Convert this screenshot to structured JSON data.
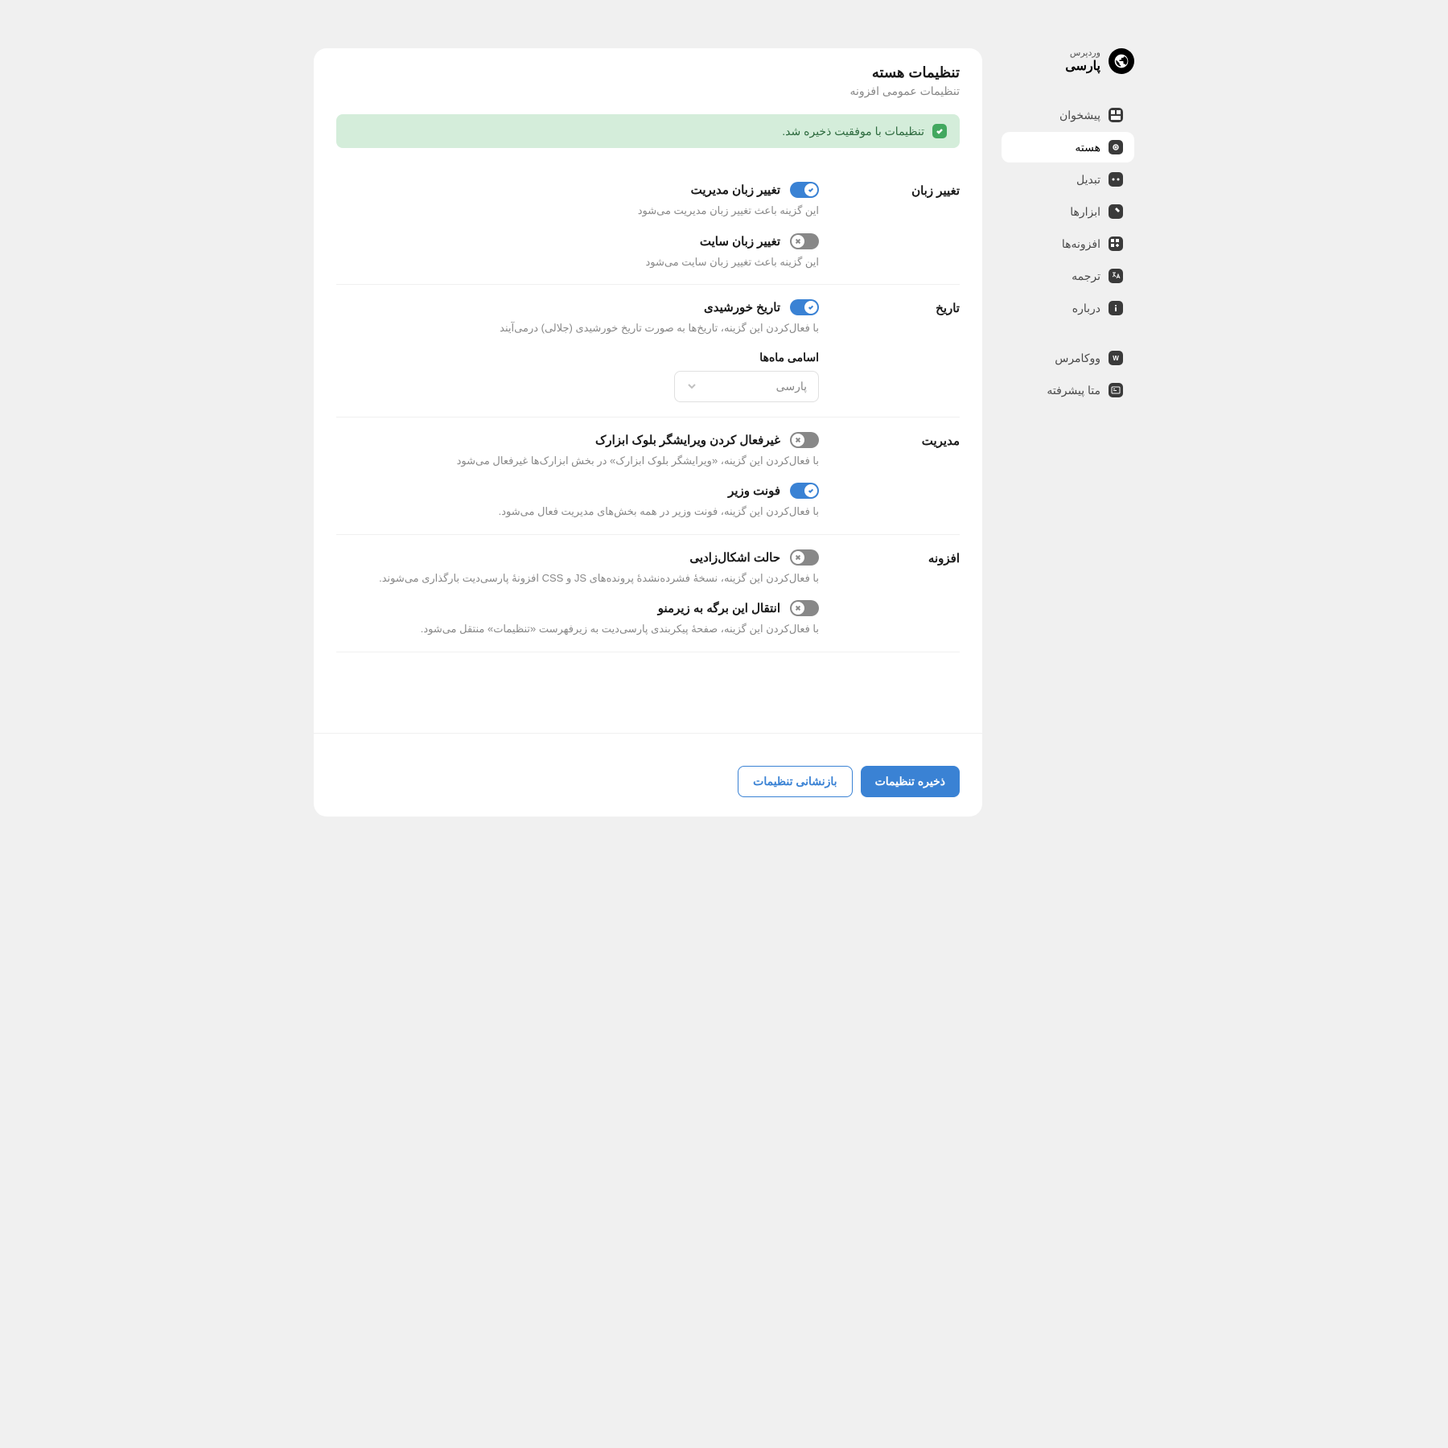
{
  "logo": {
    "sub": "وردپرس",
    "main": "پارسی"
  },
  "nav": {
    "primary": [
      {
        "label": "پیشخوان",
        "icon": "dashboard"
      },
      {
        "label": "هسته",
        "icon": "core",
        "active": true
      },
      {
        "label": "تبدیل",
        "icon": "convert"
      },
      {
        "label": "ابزارها",
        "icon": "tools"
      },
      {
        "label": "افزونه‌ها",
        "icon": "plugins"
      },
      {
        "label": "ترجمه",
        "icon": "translate"
      },
      {
        "label": "درباره",
        "icon": "info"
      }
    ],
    "secondary": [
      {
        "label": "ووکامرس",
        "icon": "woocommerce"
      },
      {
        "label": "متا پیشرفته",
        "icon": "acf"
      }
    ]
  },
  "header": {
    "title": "تنظیمات هسته",
    "subtitle": "تنظیمات عمومی افزونه"
  },
  "alert": {
    "text": "تنظیمات با موفقیت ذخیره شد."
  },
  "sections": {
    "lang": {
      "label": "تغییر زبان",
      "opts": [
        {
          "title": "تغییر زبان مدیریت",
          "desc": "این گزینه باعث تغییر زبان مدیریت می‌شود",
          "on": true
        },
        {
          "title": "تغییر زبان سایت",
          "desc": "این گزینه باعث تغییر زبان سایت می‌شود",
          "on": false
        }
      ]
    },
    "date": {
      "label": "تاریخ",
      "opts": [
        {
          "title": "تاریخ خورشیدی",
          "desc": "با فعال‌کردن این گزینه، تاریخ‌ها به صورت تاریخ خورشیدی (جلالی) درمی‌آیند",
          "on": true
        }
      ],
      "subfield": {
        "label": "اسامی ماه‌ها",
        "value": "پارسی"
      }
    },
    "admin": {
      "label": "مدیریت",
      "opts": [
        {
          "title": "غیرفعال کردن ویرایشگر بلوک ابزارک",
          "desc": "با فعال‌کردن این گزینه، «ویرایشگر بلوک ابزارک» در بخش ابزارک‌ها غیرفعال می‌شود",
          "on": false
        },
        {
          "title": "فونت وزیر",
          "desc": "با فعال‌کردن این گزینه، فونت وزیر در همه بخش‌های مدیریت فعال می‌شود.",
          "on": true
        }
      ]
    },
    "plugin": {
      "label": "افزونه",
      "opts": [
        {
          "title": "حالت اشکال‌زادیی",
          "desc": "با فعال‌کردن این گزینه، نسخهٔ فشرده‌نشدهٔ پرونده‌های JS و CSS افزونهٔ پارسی‌دیت بارگذاری می‌شوند.",
          "on": false
        },
        {
          "title": "انتقال این برگه به زیرمنو",
          "desc": "با فعال‌کردن این گزینه، صفحهٔ پیکربندی پارسی‌دیت به زیرفهرست «تنظیمات» منتقل می‌شود.",
          "on": false
        }
      ]
    }
  },
  "actions": {
    "save": "ذخیره تنظیمات",
    "reset": "بازنشانی تنظیمات"
  }
}
